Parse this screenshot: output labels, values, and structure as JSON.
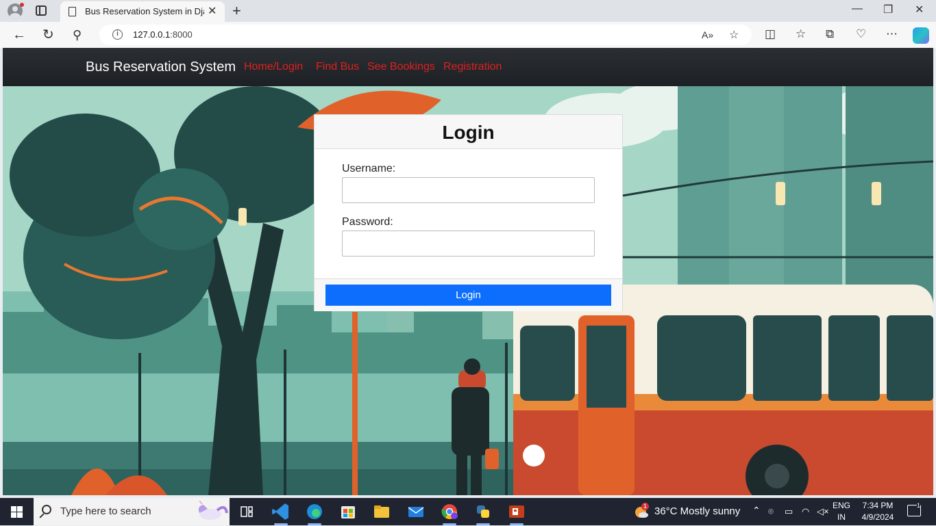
{
  "browser": {
    "tab_title": "Bus Reservation System in Django",
    "url_host": "127.0.0.1",
    "url_port": ":8000"
  },
  "site": {
    "brand": "Bus Reservation System",
    "nav": [
      {
        "label": "Home/Login"
      },
      {
        "label": "Find Bus"
      },
      {
        "label": "See Bookings"
      },
      {
        "label": "Registration"
      }
    ],
    "nav_color": "#e02020"
  },
  "login": {
    "title": "Login",
    "username_label": "Username:",
    "username_value": "",
    "password_label": "Password:",
    "password_value": "",
    "button_label": "Login",
    "button_color": "#0d6efd"
  },
  "taskbar": {
    "search_placeholder": "Type here to search",
    "weather": "36°C  Mostly sunny",
    "weather_badge": "1",
    "lang_line1": "ENG",
    "lang_line2": "IN",
    "time": "7:34 PM",
    "date": "4/9/2024",
    "notification_count": "1"
  }
}
